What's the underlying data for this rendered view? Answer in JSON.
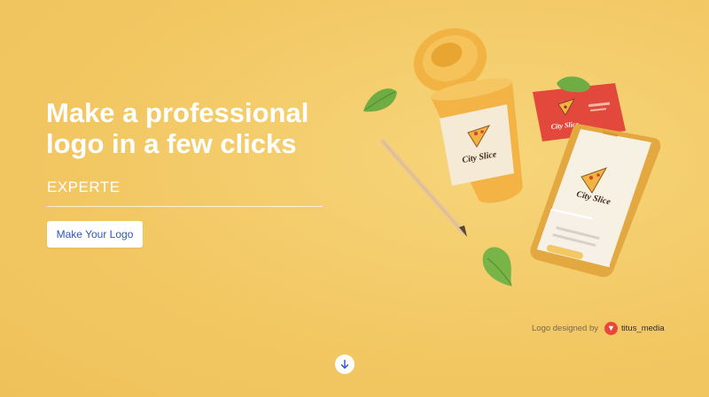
{
  "hero": {
    "title": "Make a professional logo in a few clicks",
    "brand": "EXPERTE",
    "cta_label": "Make Your Logo"
  },
  "mockup": {
    "cup_logo_text": "City Slice",
    "card_logo_text": "City Slice",
    "phone_logo_text": "City Slice"
  },
  "credit": {
    "label": "Logo designed by",
    "designer": "titus_media"
  },
  "colors": {
    "background": "#f2c864",
    "cta_text": "#2d56b8",
    "card": "#e2483b",
    "cup": "#f3b445",
    "leaf": "#7ab54a"
  },
  "icons": {
    "scroll": "arrow-down-icon",
    "designer_avatar": "titus-media-avatar"
  }
}
